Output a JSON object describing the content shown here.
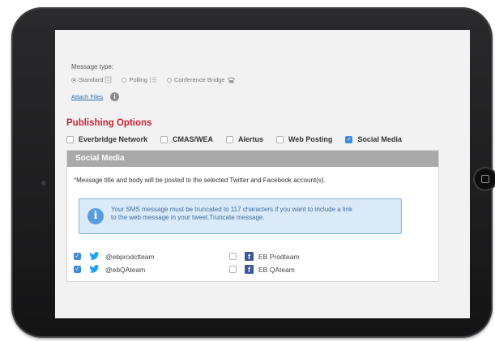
{
  "form": {
    "message_type_label": "Message type:",
    "message_types": [
      {
        "label": "Standard",
        "selected": true
      },
      {
        "label": "Polling",
        "selected": false
      },
      {
        "label": "Conference Bridge",
        "selected": false
      }
    ],
    "attach_files_label": "Attach Files",
    "info_glyph": "i"
  },
  "publishing": {
    "title": "Publishing Options",
    "options": [
      {
        "label": "Everbridge Network",
        "checked": false
      },
      {
        "label": "CMAS/WEA",
        "checked": false
      },
      {
        "label": "Alertus",
        "checked": false
      },
      {
        "label": "Web Posting",
        "checked": false
      },
      {
        "label": "Social Media",
        "checked": true
      }
    ]
  },
  "social_media": {
    "header": "Social Media",
    "note_star": "*",
    "note": "Message title and body will be posted to the selected Twitter and Facebook account(s).",
    "info_icon_glyph": "i",
    "info_line1": "Your SMS message must be truncated to 117 characters if you want to include a link",
    "info_line2": "to the web message in your tweet.Truncate message.",
    "twitter_accounts": [
      {
        "handle": "@ebprodctteam",
        "checked": true
      },
      {
        "handle": "@ebQAteam",
        "checked": true
      }
    ],
    "facebook_accounts": [
      {
        "name": "EB Prodteam",
        "checked": false
      },
      {
        "name": "EB QAteam",
        "checked": false
      }
    ],
    "facebook_glyph": "f"
  },
  "colors": {
    "accent_red": "#c8253a",
    "checkbox_blue": "#3f8ad9",
    "twitter_blue": "#1da1f2",
    "facebook_blue": "#3b5998",
    "info_box_bg": "#dbeaf8"
  }
}
